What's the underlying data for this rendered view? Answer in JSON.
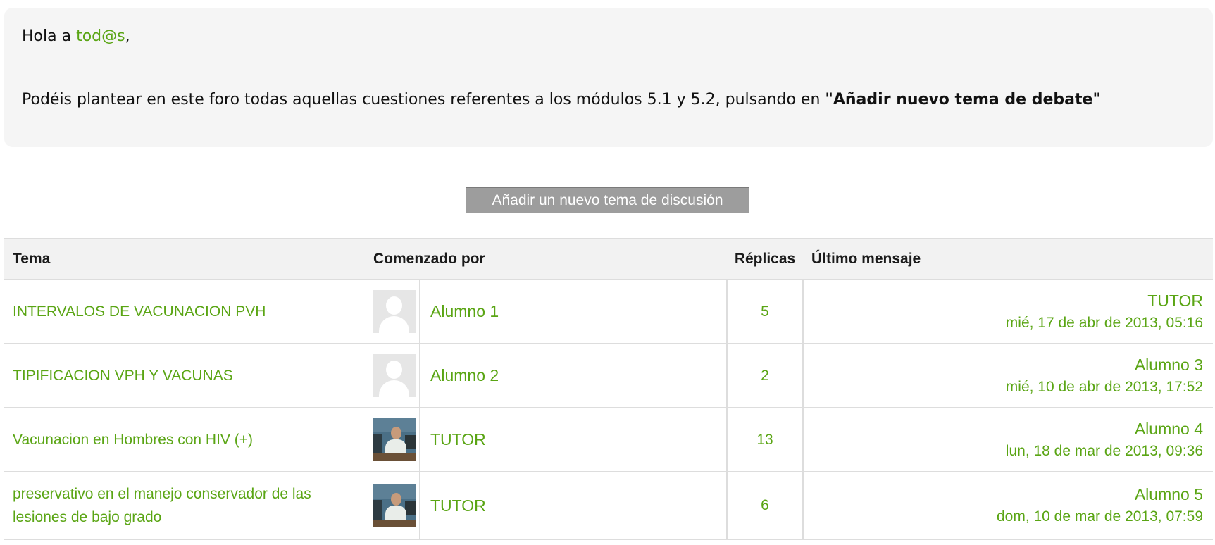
{
  "intro": {
    "greeting_prefix": "Hola a ",
    "greeting_link": "tod@s",
    "greeting_suffix": ",",
    "body_text": "Podéis plantear en este foro todas aquellas cuestiones referentes a los módulos 5.1 y 5.2, pulsando en ",
    "body_bold": "\"Añadir nuevo tema de debate\""
  },
  "add_button_label": "Añadir un nuevo tema de discusión",
  "table": {
    "headers": {
      "tema": "Tema",
      "comenzado": "Comenzado por",
      "replicas": "Réplicas",
      "ultimo": "Último mensaje"
    },
    "rows": [
      {
        "tema": "INTERVALOS DE VACUNACION PVH",
        "author": "Alumno 1",
        "avatar": "default-user-icon",
        "replicas": "5",
        "last_author": "TUTOR",
        "last_date": "mié, 17 de abr de 2013, 05:16"
      },
      {
        "tema": "TIPIFICACION VPH Y VACUNAS",
        "author": "Alumno 2",
        "avatar": "default-user-icon",
        "replicas": "2",
        "last_author": "Alumno 3",
        "last_date": "mié, 10 de abr de 2013, 17:52"
      },
      {
        "tema": "Vacunacion en Hombres con HIV (+)",
        "author": "TUTOR",
        "avatar": "tutor-photo",
        "replicas": "13",
        "last_author": "Alumno 4",
        "last_date": "lun, 18 de mar de 2013, 09:36"
      },
      {
        "tema": "preservativo en el manejo conservador de las lesiones de bajo grado",
        "author": "TUTOR",
        "avatar": "tutor-photo",
        "replicas": "6",
        "last_author": "Alumno 5",
        "last_date": "dom, 10 de mar de 2013, 07:59"
      }
    ]
  },
  "colors": {
    "link": "#5aa514",
    "intro_bg": "#f5f5f5",
    "header_bg": "#f2f2f2",
    "button_bg": "#9d9d9d"
  }
}
